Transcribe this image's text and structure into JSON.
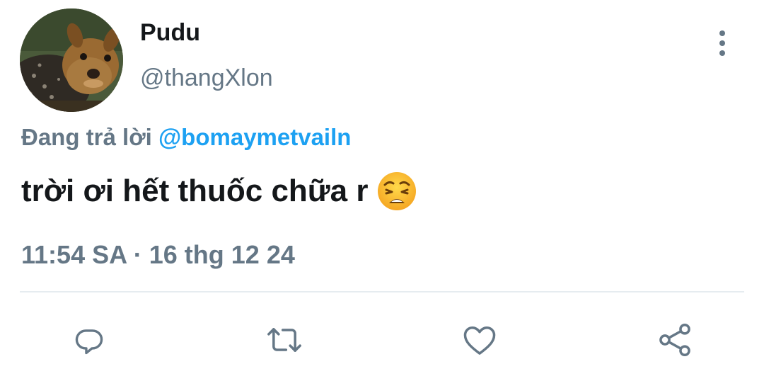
{
  "tweet": {
    "display_name": "Pudu",
    "handle": "@thangXlon",
    "reply_prefix": "Đang trả lời ",
    "reply_mention": "@bomaymetvailn",
    "text": "trời ơi hết thuốc chữa r",
    "emoji": "weary-face",
    "timestamp": "11:54 SA · 16 thg 12 24"
  },
  "icons": {
    "more": "vertical-ellipsis-icon",
    "reply": "speech-bubble-icon",
    "retweet": "retweet-icon",
    "like": "heart-icon",
    "share": "share-icon"
  },
  "colors": {
    "primary_text": "#14171a",
    "secondary_text": "#657786",
    "link": "#1da1f2",
    "divider": "#e6ecf0",
    "icon": "#657786"
  }
}
